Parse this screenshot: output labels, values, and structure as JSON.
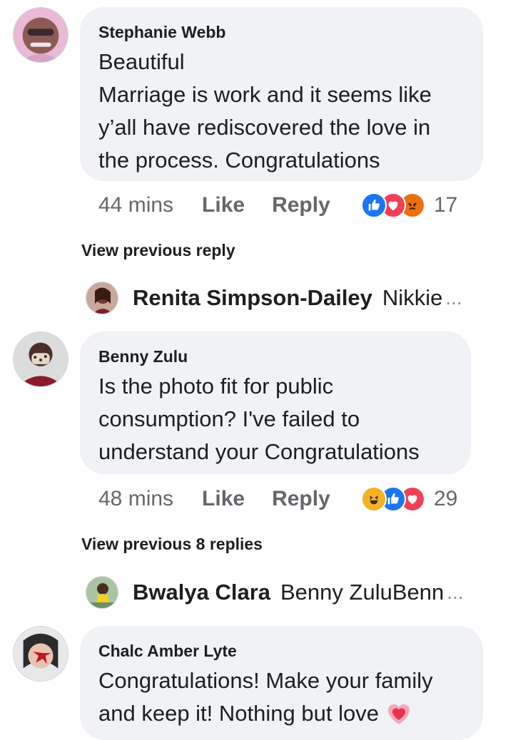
{
  "comments": [
    {
      "author": "Stephanie Webb",
      "lines": [
        "Beautiful",
        "Marriage is work and it seems like",
        "y’all have rediscovered the love in",
        "the process. Congratulations"
      ],
      "time": "44 mins",
      "like": "Like",
      "reply": "Reply",
      "reactions": [
        "like-icon",
        "love-icon",
        "angry-icon"
      ],
      "reaction_count": "17"
    },
    {
      "author": "Benny Zulu",
      "lines": [
        "Is the photo fit for public",
        "consumption? I've failed to",
        "understand your Congratulations"
      ],
      "time": "48 mins",
      "like": "Like",
      "reply": "Reply",
      "reactions": [
        "haha-icon",
        "like-icon",
        "love-icon"
      ],
      "reaction_count": "29"
    },
    {
      "author": "Chalc Amber Lyte",
      "lines": [
        "Congratulations! Make your family",
        "and keep it! Nothing but love"
      ]
    }
  ],
  "reply_threads": [
    {
      "view_previous": "View previous reply",
      "name": "Renita Simpson-Dailey",
      "snippet": "Nikkie",
      "ellipsis": "..."
    },
    {
      "view_previous": "View previous 8 replies",
      "name": "Bwalya Clara",
      "snippet": "Benny ZuluBenn",
      "ellipsis": "..."
    }
  ],
  "colors": {
    "bubble": "#f0f2f5",
    "secondary_text": "#65676b",
    "like_blue": "#1877f2",
    "love_red": "#f33e58",
    "angry_orange": "#e9710f",
    "haha_yellow": "#f7b125"
  }
}
